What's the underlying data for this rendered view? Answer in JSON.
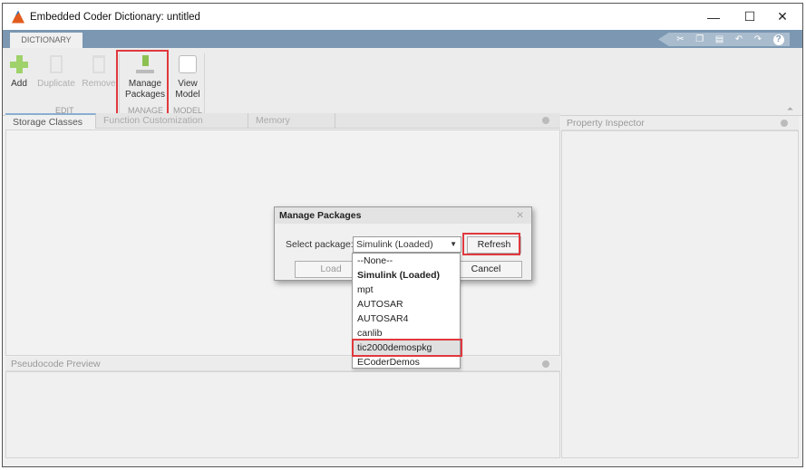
{
  "window": {
    "title": "Embedded Coder Dictionary: untitled",
    "minimize": "—",
    "maximize": "☐",
    "close": "✕"
  },
  "ribbon": {
    "tab": "DICTIONARY",
    "quick_access": [
      "cut-icon",
      "copy-icon",
      "paste-icon",
      "undo-icon",
      "redo-icon",
      "help-icon"
    ],
    "buttons": {
      "add": "Add",
      "duplicate": "Duplicate",
      "remove": "Remove",
      "manage1": "Manage",
      "manage2": "Packages",
      "view1": "View",
      "view2": "Model"
    },
    "groups": {
      "edit": "EDIT",
      "manage": "MANAGE",
      "model": "MODEL"
    }
  },
  "tabs": [
    "Storage Classes",
    "Function Customization Templates",
    "Memory Sections"
  ],
  "panes": {
    "property_inspector": "Property Inspector",
    "pseudocode": "Pseudocode Preview"
  },
  "dialog": {
    "title": "Manage Packages",
    "select_label": "Select package:",
    "selected": "Simulink (Loaded)",
    "refresh": "Refresh",
    "load": "Load",
    "cancel": "Cancel",
    "options": [
      "--None--",
      "Simulink (Loaded)",
      "mpt",
      "AUTOSAR",
      "AUTOSAR4",
      "canlib",
      "tic2000demospkg",
      "ECoderDemos"
    ]
  },
  "highlight_color": "#e0393e"
}
